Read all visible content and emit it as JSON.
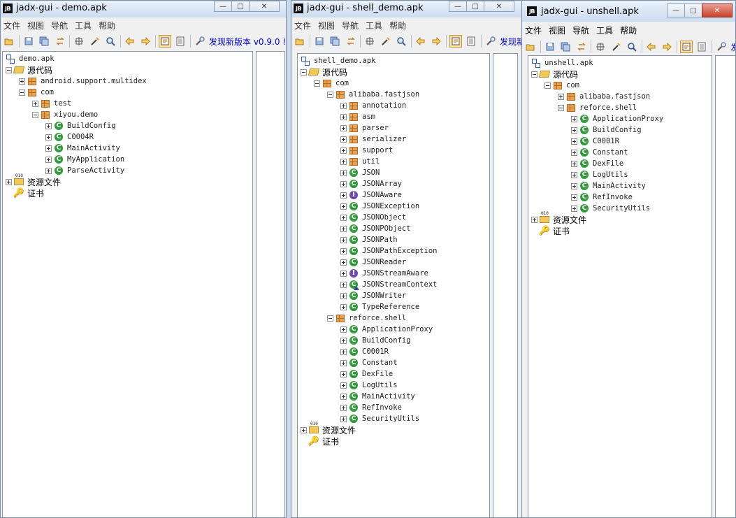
{
  "windows": [
    {
      "title": "jadx-gui - demo.apk",
      "menu": [
        "文件",
        "视图",
        "导航",
        "工具",
        "帮助"
      ],
      "new_version": "发现新版本 v0.9.0 !",
      "tree": [
        {
          "label": "demo.apk",
          "icon": "apk-icon",
          "level": 0,
          "toggle": "none"
        },
        {
          "label": "源代码",
          "icon": "folder-open-icon",
          "level": 0,
          "toggle": "minus"
        },
        {
          "label": "android.support.multidex",
          "icon": "package-icon",
          "level": 1,
          "toggle": "plus"
        },
        {
          "label": "com",
          "icon": "package-icon",
          "level": 1,
          "toggle": "minus"
        },
        {
          "label": "test",
          "icon": "package-icon",
          "level": 2,
          "toggle": "plus"
        },
        {
          "label": "xiyou.demo",
          "icon": "package-icon",
          "level": 2,
          "toggle": "minus"
        },
        {
          "label": "BuildConfig",
          "icon": "class-icon",
          "level": 3,
          "toggle": "plus"
        },
        {
          "label": "C0004R",
          "icon": "class-icon",
          "level": 3,
          "toggle": "plus"
        },
        {
          "label": "MainActivity",
          "icon": "class-icon",
          "level": 3,
          "toggle": "plus"
        },
        {
          "label": "MyApplication",
          "icon": "class-icon",
          "level": 3,
          "toggle": "plus"
        },
        {
          "label": "ParseActivity",
          "icon": "class-icon",
          "level": 3,
          "toggle": "plus"
        },
        {
          "label": "资源文件",
          "icon": "resource-folder-icon",
          "level": 0,
          "toggle": "plus"
        },
        {
          "label": "证书",
          "icon": "key-icon",
          "level": 0,
          "toggle": "none"
        }
      ]
    },
    {
      "title": "jadx-gui - shell_demo.apk",
      "menu": [
        "文件",
        "视图",
        "导航",
        "工具",
        "帮助"
      ],
      "new_version": "发现新",
      "tree": [
        {
          "label": "shell_demo.apk",
          "icon": "apk-icon",
          "level": 0,
          "toggle": "none"
        },
        {
          "label": "源代码",
          "icon": "folder-open-icon",
          "level": 0,
          "toggle": "minus"
        },
        {
          "label": "com",
          "icon": "package-icon",
          "level": 1,
          "toggle": "minus"
        },
        {
          "label": "alibaba.fastjson",
          "icon": "package-icon",
          "level": 2,
          "toggle": "minus"
        },
        {
          "label": "annotation",
          "icon": "package-icon",
          "level": 3,
          "toggle": "plus"
        },
        {
          "label": "asm",
          "icon": "package-icon",
          "level": 3,
          "toggle": "plus"
        },
        {
          "label": "parser",
          "icon": "package-icon",
          "level": 3,
          "toggle": "plus"
        },
        {
          "label": "serializer",
          "icon": "package-icon",
          "level": 3,
          "toggle": "plus"
        },
        {
          "label": "support",
          "icon": "package-icon",
          "level": 3,
          "toggle": "plus"
        },
        {
          "label": "util",
          "icon": "package-icon",
          "level": 3,
          "toggle": "plus"
        },
        {
          "label": "JSON",
          "icon": "class-icon",
          "level": 3,
          "toggle": "plus"
        },
        {
          "label": "JSONArray",
          "icon": "class-icon",
          "level": 3,
          "toggle": "plus"
        },
        {
          "label": "JSONAware",
          "icon": "interface-icon",
          "level": 3,
          "toggle": "plus"
        },
        {
          "label": "JSONException",
          "icon": "class-icon",
          "level": 3,
          "toggle": "plus"
        },
        {
          "label": "JSONObject",
          "icon": "class-icon",
          "level": 3,
          "toggle": "plus"
        },
        {
          "label": "JSONPObject",
          "icon": "class-icon",
          "level": 3,
          "toggle": "plus"
        },
        {
          "label": "JSONPath",
          "icon": "class-icon",
          "level": 3,
          "toggle": "plus"
        },
        {
          "label": "JSONPathException",
          "icon": "class-icon",
          "level": 3,
          "toggle": "plus"
        },
        {
          "label": "JSONReader",
          "icon": "class-icon",
          "level": 3,
          "toggle": "plus"
        },
        {
          "label": "JSONStreamAware",
          "icon": "interface-icon",
          "level": 3,
          "toggle": "plus"
        },
        {
          "label": "JSONStreamContext",
          "icon": "abstract-class-icon",
          "level": 3,
          "toggle": "plus"
        },
        {
          "label": "JSONWriter",
          "icon": "class-icon",
          "level": 3,
          "toggle": "plus"
        },
        {
          "label": "TypeReference",
          "icon": "class-icon",
          "level": 3,
          "toggle": "plus"
        },
        {
          "label": "reforce.shell",
          "icon": "package-icon",
          "level": 2,
          "toggle": "minus"
        },
        {
          "label": "ApplicationProxy",
          "icon": "class-icon",
          "level": 3,
          "toggle": "plus"
        },
        {
          "label": "BuildConfig",
          "icon": "class-icon",
          "level": 3,
          "toggle": "plus"
        },
        {
          "label": "C0001R",
          "icon": "class-icon",
          "level": 3,
          "toggle": "plus"
        },
        {
          "label": "Constant",
          "icon": "class-icon",
          "level": 3,
          "toggle": "plus"
        },
        {
          "label": "DexFile",
          "icon": "class-icon",
          "level": 3,
          "toggle": "plus"
        },
        {
          "label": "LogUtils",
          "icon": "class-icon",
          "level": 3,
          "toggle": "plus"
        },
        {
          "label": "MainActivity",
          "icon": "class-icon",
          "level": 3,
          "toggle": "plus"
        },
        {
          "label": "RefInvoke",
          "icon": "class-icon",
          "level": 3,
          "toggle": "plus"
        },
        {
          "label": "SecurityUtils",
          "icon": "class-icon",
          "level": 3,
          "toggle": "plus"
        },
        {
          "label": "资源文件",
          "icon": "resource-folder-icon",
          "level": 0,
          "toggle": "plus"
        },
        {
          "label": "证书",
          "icon": "key-icon",
          "level": 0,
          "toggle": "none"
        }
      ]
    },
    {
      "title": "jadx-gui - unshell.apk",
      "menu": [
        "文件",
        "视图",
        "导航",
        "工具",
        "帮助"
      ],
      "new_version": "发",
      "tree": [
        {
          "label": "unshell.apk",
          "icon": "apk-icon",
          "level": 0,
          "toggle": "none"
        },
        {
          "label": "源代码",
          "icon": "folder-open-icon",
          "level": 0,
          "toggle": "minus"
        },
        {
          "label": "com",
          "icon": "package-icon",
          "level": 1,
          "toggle": "minus"
        },
        {
          "label": "alibaba.fastjson",
          "icon": "package-icon",
          "level": 2,
          "toggle": "plus"
        },
        {
          "label": "reforce.shell",
          "icon": "package-icon",
          "level": 2,
          "toggle": "minus"
        },
        {
          "label": "ApplicationProxy",
          "icon": "class-icon",
          "level": 3,
          "toggle": "plus"
        },
        {
          "label": "BuildConfig",
          "icon": "class-icon",
          "level": 3,
          "toggle": "plus"
        },
        {
          "label": "C0001R",
          "icon": "class-icon",
          "level": 3,
          "toggle": "plus"
        },
        {
          "label": "Constant",
          "icon": "class-icon",
          "level": 3,
          "toggle": "plus"
        },
        {
          "label": "DexFile",
          "icon": "class-icon",
          "level": 3,
          "toggle": "plus"
        },
        {
          "label": "LogUtils",
          "icon": "class-icon",
          "level": 3,
          "toggle": "plus"
        },
        {
          "label": "MainActivity",
          "icon": "class-icon",
          "level": 3,
          "toggle": "plus"
        },
        {
          "label": "RefInvoke",
          "icon": "class-icon",
          "level": 3,
          "toggle": "plus"
        },
        {
          "label": "SecurityUtils",
          "icon": "class-icon",
          "level": 3,
          "toggle": "plus"
        },
        {
          "label": "资源文件",
          "icon": "resource-folder-icon",
          "level": 0,
          "toggle": "plus"
        },
        {
          "label": "证书",
          "icon": "key-icon",
          "level": 0,
          "toggle": "none"
        }
      ]
    }
  ],
  "toolbar_icons": [
    "open-file-icon",
    "save-icon",
    "save-all-icon",
    "sync-icon",
    "flatten-packages-icon",
    "decompile-icon",
    "search-icon",
    "back-icon",
    "forward-icon",
    "log-icon",
    "viewer-icon",
    "preferences-icon"
  ]
}
